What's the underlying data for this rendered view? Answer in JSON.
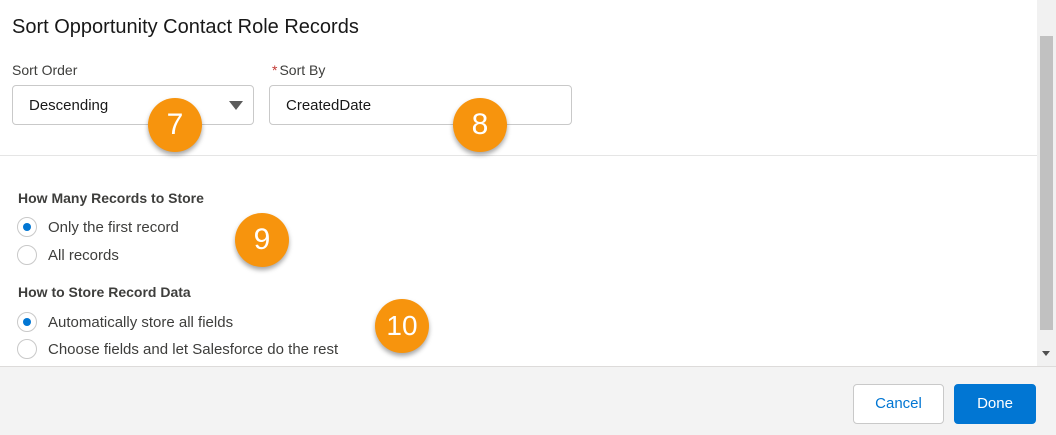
{
  "section": {
    "title": "Sort Opportunity Contact Role Records"
  },
  "sort_order": {
    "label": "Sort Order",
    "value": "Descending"
  },
  "sort_by": {
    "required_mark": "*",
    "label": "Sort By",
    "value": "CreatedDate"
  },
  "records_to_store": {
    "label": "How Many Records to Store",
    "options": [
      {
        "label": "Only the first record",
        "selected": true
      },
      {
        "label": "All records",
        "selected": false
      }
    ]
  },
  "store_record_data": {
    "label": "How to Store Record Data",
    "options": [
      {
        "label": "Automatically store all fields",
        "selected": true
      },
      {
        "label": "Choose fields and let Salesforce do the rest",
        "selected": false
      }
    ]
  },
  "badges": [
    "7",
    "8",
    "9",
    "10"
  ],
  "footer": {
    "cancel_label": "Cancel",
    "done_label": "Done"
  },
  "colors": {
    "brand": "#0176d3",
    "badge": "#f7940d",
    "required": "#c23934"
  }
}
